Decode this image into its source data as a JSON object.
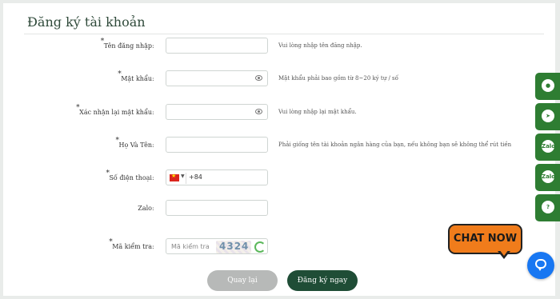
{
  "form": {
    "title": "Đăng ký tài khoản",
    "required_mark": "*",
    "colon": ":",
    "username": {
      "label": "Tên đăng nhập",
      "value": "",
      "hint": "Vui lòng nhập tên đăng nhập."
    },
    "password": {
      "label": "Mật khẩu",
      "value": "",
      "hint": "Mật khẩu phải bao gồm từ 8~20 ký tự / số"
    },
    "confirm_password": {
      "label": "Xác nhận lại mật khẩu",
      "value": "",
      "hint": "Vui lòng nhập lại mật khẩu."
    },
    "full_name": {
      "label": "Họ Và Tên",
      "value": "",
      "hint": "Phải giống tên tài khoản ngân hàng của bạn, nếu không bạn sẽ không thể rút tiền"
    },
    "phone": {
      "label": "Số điện thoại",
      "country_code": "+84",
      "value": ""
    },
    "zalo": {
      "label": "Zalo",
      "value": ""
    },
    "captcha": {
      "label": "Mã kiểm tra",
      "placeholder": "Mã kiểm tra",
      "code": "4324"
    },
    "back_button": "Quay lại",
    "submit_button": "Đăng ký ngay"
  },
  "side_bar": {
    "items": [
      {
        "icon": "support-agent-icon",
        "text": ""
      },
      {
        "icon": "telegram-icon",
        "text": ""
      },
      {
        "icon": "zalo-icon",
        "text": "Zalo"
      },
      {
        "icon": "zalo-icon",
        "text": "Zalo"
      },
      {
        "icon": "help-icon",
        "text": "?"
      }
    ]
  },
  "chat": {
    "label": "CHAT NOW",
    "color": "#f07c1b"
  },
  "colors": {
    "accent": "#1f4d36",
    "side_bar": "#2e7d32",
    "messenger": "#1877f2"
  }
}
